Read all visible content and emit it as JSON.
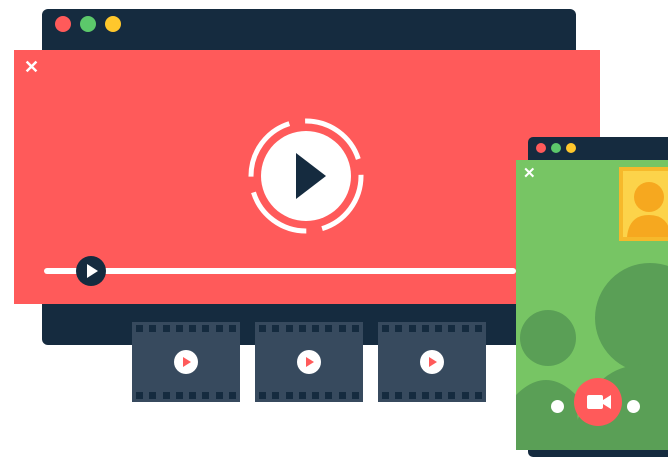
{
  "main_window": {
    "traffic_lights": [
      "#ff5a5a",
      "#5cc86b",
      "#ffc72c"
    ],
    "close_symbol": "✕"
  },
  "player": {
    "play_icon": "play-icon",
    "progress": 0.1
  },
  "thumbnails": [
    {
      "icon": "play-icon"
    },
    {
      "icon": "play-icon"
    },
    {
      "icon": "play-icon"
    }
  ],
  "call_window": {
    "traffic_lights": [
      "#ff5a5a",
      "#5cc86b",
      "#ffc72c"
    ],
    "close_symbol": "✕",
    "camera_icon": "video-camera-icon"
  },
  "colors": {
    "navy": "#152b3f",
    "red": "#ff5a5a",
    "green": "#77c564",
    "dark_green": "#5a9f56",
    "yellow": "#fcd34a"
  }
}
